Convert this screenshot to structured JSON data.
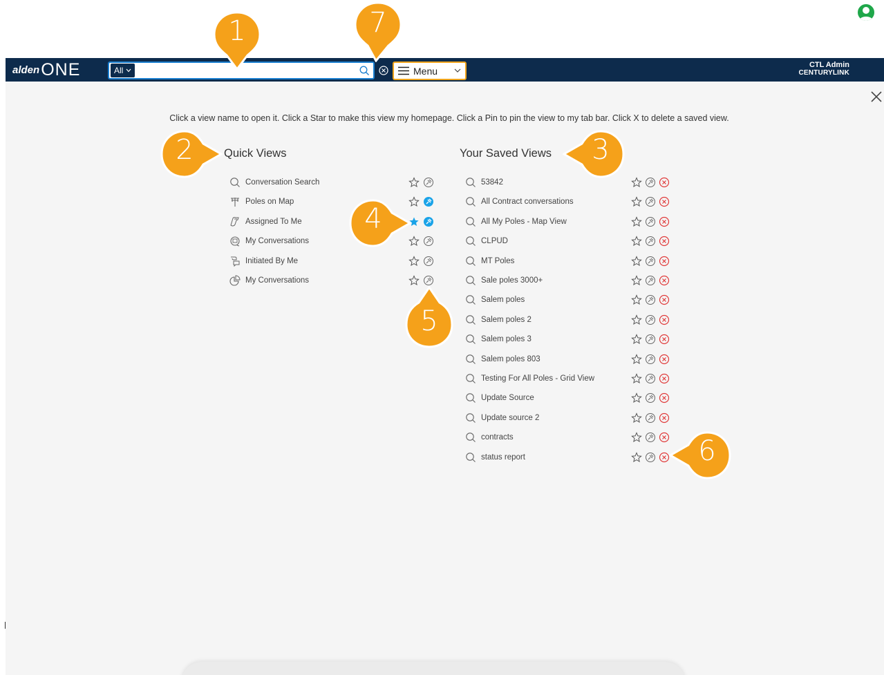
{
  "app": {
    "logo_prefix": "alden",
    "logo_suffix": "ONE"
  },
  "search": {
    "scope": "All",
    "placeholder": "",
    "value": ""
  },
  "menu": {
    "label": "Menu"
  },
  "user": {
    "name": "CTL Admin",
    "org": "CENTURYLINK"
  },
  "instructions": "Click a view name to open it. Click a Star to make this view my homepage. Click a Pin to pin the view to my tab bar. Click X to delete a saved view.",
  "quick_views": {
    "title": "Quick Views",
    "items": [
      {
        "label": "Conversation Search",
        "icon": "search-icon",
        "starred": false,
        "pinned": false
      },
      {
        "label": "Poles on Map",
        "icon": "pole-icon",
        "starred": false,
        "pinned": true
      },
      {
        "label": "Assigned To Me",
        "icon": "assigned-icon",
        "starred": true,
        "pinned": true
      },
      {
        "label": "My Conversations",
        "icon": "conversation-icon",
        "starred": false,
        "pinned": false
      },
      {
        "label": "Initiated By Me",
        "icon": "initiated-icon",
        "starred": false,
        "pinned": false
      },
      {
        "label": "My Conversations",
        "icon": "pie-icon",
        "starred": false,
        "pinned": false
      }
    ]
  },
  "saved_views": {
    "title": "Your Saved Views",
    "items": [
      {
        "label": "53842"
      },
      {
        "label": "All Contract conversations"
      },
      {
        "label": "All My Poles - Map View"
      },
      {
        "label": "CLPUD"
      },
      {
        "label": "MT Poles"
      },
      {
        "label": "Sale poles 3000+"
      },
      {
        "label": "Salem poles"
      },
      {
        "label": "Salem poles 2"
      },
      {
        "label": "Salem poles 3"
      },
      {
        "label": "Salem poles 803"
      },
      {
        "label": "Testing For All Poles - Grid View"
      },
      {
        "label": "Update Source"
      },
      {
        "label": "Update source 2"
      },
      {
        "label": "contracts"
      },
      {
        "label": "status report"
      }
    ]
  },
  "callouts": [
    "1",
    "2",
    "3",
    "4",
    "5",
    "6",
    "7"
  ],
  "colors": {
    "topbar": "#0d2b4c",
    "accent": "#1a7fd0",
    "callout": "#f5a11a",
    "pin_active": "#1aa3e8",
    "delete": "#e03a3a",
    "menu_border": "#f0a41c"
  }
}
